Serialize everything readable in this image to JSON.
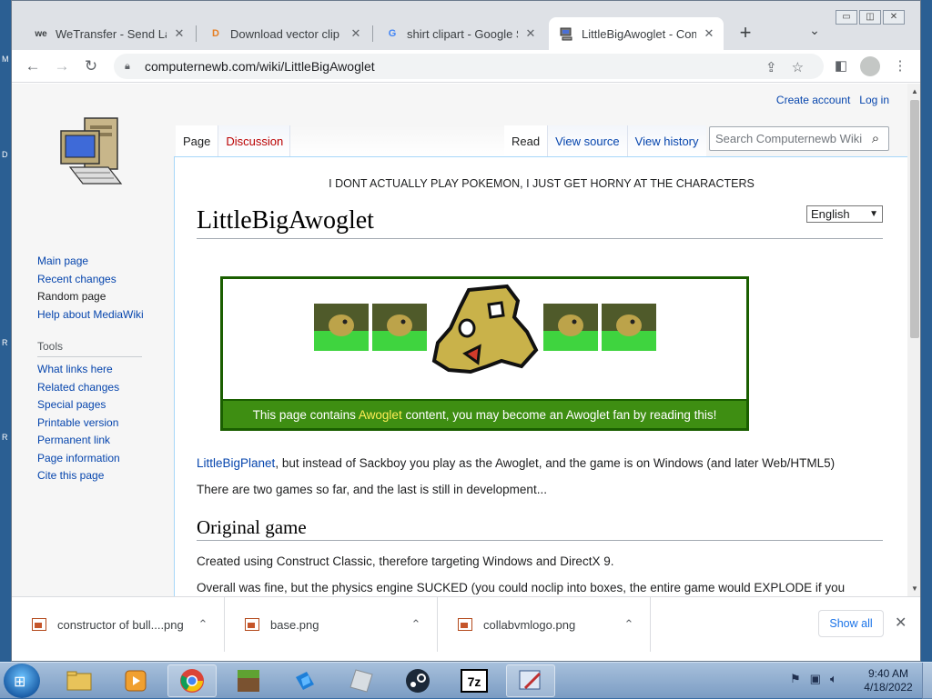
{
  "browser": {
    "tabs": [
      {
        "title": "WeTransfer - Send Large",
        "favicon": "we"
      },
      {
        "title": "Download vector clip art",
        "favicon": "D"
      },
      {
        "title": "shirt clipart - Google Se",
        "favicon": "G"
      },
      {
        "title": "LittleBigAwoglet - Comp",
        "favicon": "computer"
      }
    ],
    "url": "computernewb.com/wiki/LittleBigAwoglet"
  },
  "wiki": {
    "personal": {
      "create_account": "Create account",
      "login": "Log in"
    },
    "nav": [
      "Main page",
      "Recent changes",
      "Random page",
      "Help about MediaWiki"
    ],
    "tools_heading": "Tools",
    "tools": [
      "What links here",
      "Related changes",
      "Special pages",
      "Printable version",
      "Permanent link",
      "Page information",
      "Cite this page"
    ],
    "tabs_left": [
      "Page",
      "Discussion"
    ],
    "tabs_right": [
      "Read",
      "View source",
      "View history"
    ],
    "search_placeholder": "Search Computernewb Wiki",
    "sitenotice": "I DONT ACTUALLY PLAY POKEMON, I JUST GET HORNY AT THE CHARACTERS",
    "title": "LittleBigAwoglet",
    "language": "English",
    "banner": {
      "before": "This page contains ",
      "link": "Awoglet",
      "after": " content, you may become an Awoglet fan by reading this!"
    },
    "intro_link": "LittleBigPlanet",
    "intro_rest": ", but instead of Sackboy you play as the Awoglet, and the game is on Windows (and later Web/HTML5)",
    "para2": "There are two games so far, and the last is still in development...",
    "heading_original": "Original game",
    "para3": "Created using Construct Classic, therefore targeting Windows and DirectX 9.",
    "para4": "Overall was fine, but the physics engine SUCKED (you could noclip into boxes, the entire game would EXPLODE if you"
  },
  "downloads": {
    "items": [
      "constructor of bull....png",
      "base.png",
      "collabvmlogo.png"
    ],
    "show_all": "Show all"
  },
  "taskbar": {
    "time": "9:40 AM",
    "date": "4/18/2022"
  },
  "colors": {
    "link": "#0645ad",
    "new_link": "#ba0000",
    "banner_green": "#3e8e12",
    "banner_border": "#1a5e00"
  }
}
